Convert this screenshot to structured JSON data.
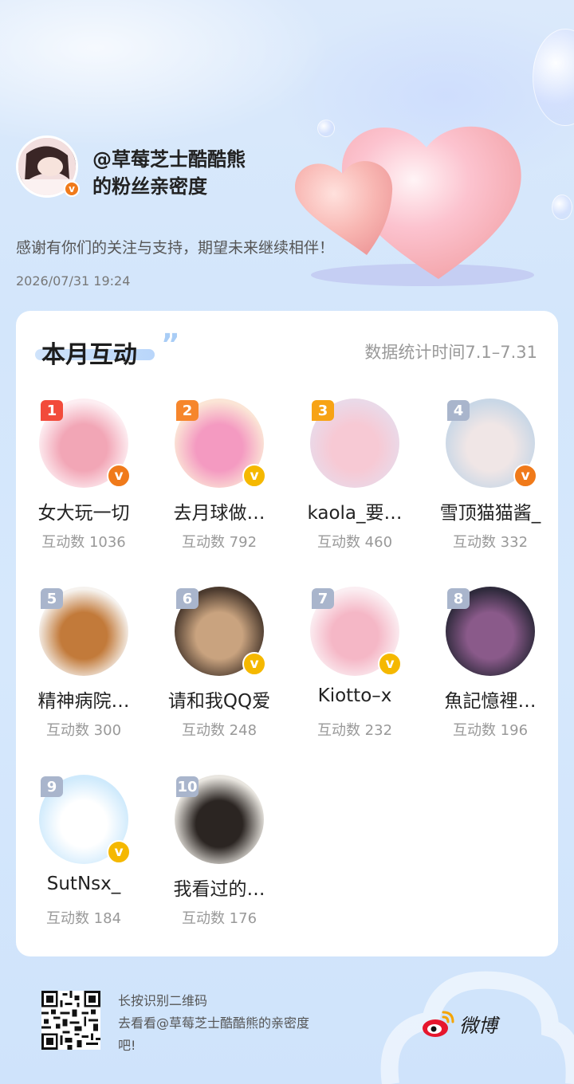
{
  "header": {
    "title_line1": "@草莓芝士酷酷熊",
    "title_line2": "的粉丝亲密度",
    "subtitle": "感谢有你们的关注与支持，期望未来继续相伴！",
    "date": "2026/07/31 19:24",
    "verify_mark": "v"
  },
  "card": {
    "title": "本月互动",
    "quote_mark": "”",
    "stat_period": "数据统计时间7.1–7.31"
  },
  "fans": [
    {
      "rank": "1",
      "name": "女大玩一切",
      "count": "互动数 1036",
      "badge": "v",
      "badge_color": "#f07a1a",
      "rank_color": "#f24b3b"
    },
    {
      "rank": "2",
      "name": "去月球做…",
      "count": "互动数 792",
      "badge": "v",
      "badge_color": "#f5b800",
      "rank_color": "#f6862c"
    },
    {
      "rank": "3",
      "name": "kaola_要…",
      "count": "互动数 460",
      "badge": "",
      "badge_color": "",
      "rank_color": "#f7a315"
    },
    {
      "rank": "4",
      "name": "雪顶猫猫酱_",
      "count": "互动数 332",
      "badge": "v",
      "badge_color": "#f07a1a",
      "rank_color": "#a9b5cc"
    },
    {
      "rank": "5",
      "name": "精神病院…",
      "count": "互动数 300",
      "badge": "",
      "badge_color": "",
      "rank_color": "#a9b5cc"
    },
    {
      "rank": "6",
      "name": "请和我QQ爱",
      "count": "互动数 248",
      "badge": "v",
      "badge_color": "#f5b800",
      "rank_color": "#a9b5cc"
    },
    {
      "rank": "7",
      "name": "Kiotto–x",
      "count": "互动数 232",
      "badge": "v",
      "badge_color": "#f5b800",
      "rank_color": "#a9b5cc"
    },
    {
      "rank": "8",
      "name": "魚記憶裡…",
      "count": "互动数 196",
      "badge": "",
      "badge_color": "",
      "rank_color": "#a9b5cc"
    },
    {
      "rank": "9",
      "name": "SutNsx_",
      "count": "互动数 184",
      "badge": "v",
      "badge_color": "#f5b800",
      "rank_color": "#a9b5cc"
    },
    {
      "rank": "10",
      "name": "我看过的…",
      "count": "互动数 176",
      "badge": "",
      "badge_color": "",
      "rank_color": "#a9b5cc"
    }
  ],
  "footer": {
    "line1": "长按识别二维码",
    "line2": "去看看@草莓芝士酷酷熊的亲密度",
    "line3": "吧!",
    "brand": "微博"
  },
  "colors": {
    "accent_blue": "#cfe3fb",
    "verify_orange": "#f07a1a",
    "verify_yellow": "#f5b800"
  }
}
